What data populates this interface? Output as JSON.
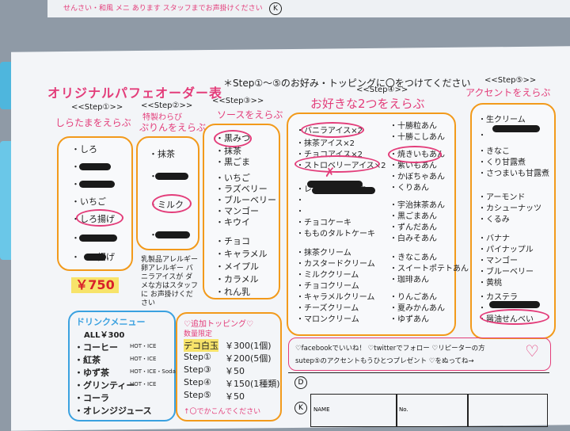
{
  "top": {
    "text": "せんさい・和風 メニ あります スタッフまでお声掛けください",
    "k": "K"
  },
  "title": "オリジナルパフェオーダー表",
  "instruction": "＊Step①〜⑤のお好み・トッピングに〇をつけてください",
  "steps": {
    "s1": "<<Step①>>",
    "s2": "<<Step②>>",
    "s3": "<<Step③>>",
    "s4": "<<Step④>>",
    "s5": "<<Step⑤>>"
  },
  "step1": {
    "sub": "しらたまをえらぶ",
    "items": [
      "・しろ",
      "・",
      "・",
      "・いちご",
      "・しろ揚げ",
      "・",
      "・　　揚げ"
    ]
  },
  "step2": {
    "sub1": "特製わらび",
    "sub2": "ぷりんをえらぶ",
    "items": [
      "・抹茶",
      "・",
      "・ミルク",
      "・"
    ]
  },
  "step3": {
    "sub": "ソースをえらぶ",
    "items": [
      "・黒みつ",
      "・抹茶",
      "・黒ごま",
      "・いちご",
      "・ラズベリー",
      "・ブルーベリー",
      "・マンゴー",
      "・キウイ",
      "・チョコ",
      "・キャラメル",
      "・メイプル",
      "・カラメル",
      "・れん乳"
    ]
  },
  "step4": {
    "sub": "お好きな2つをえらぶ",
    "left": [
      "・バニラアイス×2",
      "・抹茶アイス×2",
      "・チョコアイス×2",
      "・ストロベリーアイス×2",
      "・レアチーズケーキ",
      "・",
      "・",
      "・チョコケーキ",
      "・もものタルトケーキ",
      "・抹茶クリーム",
      "・カスタードクリーム",
      "・ミルククリーム",
      "・チョコクリーム",
      "・キャラメルクリーム",
      "・チーズクリーム",
      "・マロンクリーム"
    ],
    "right": [
      "・十勝粒あん",
      "・十勝こしあん",
      "・焼きいもあん",
      "・紫いもあん",
      "・かぼちゃあん",
      "・くりあん",
      "・宇治抹茶あん",
      "・黒ごまあん",
      "・ずんだあん",
      "・白みそあん",
      "・きなこあん",
      "・スイートポテトあん",
      "・珈琲あん",
      "・りんごあん",
      "・夏みかんあん",
      "・ゆずあん"
    ]
  },
  "step5": {
    "sub": "アクセントをえらぶ",
    "items": [
      "・生クリーム",
      "・",
      "・きなこ",
      "・くり甘露煮",
      "・さつまいも甘露煮",
      "・アーモンド",
      "・カシューナッツ",
      "・くるみ",
      "・バナナ",
      "・パイナップル",
      "・マンゴー",
      "・ブルーベリー",
      "・黄桃",
      "・カステラ",
      "・",
      "・醤油せんべい"
    ]
  },
  "price": "￥750",
  "allergy_note": "乳製品アレルギー 卵アレルギー バニラアイスが ダメな方はスタッフに お声掛けください",
  "drinks": {
    "title": "ドリンクメニュー",
    "all": "ALL￥300",
    "items": [
      {
        "name": "・コーヒー",
        "tag": "HOT・ICE"
      },
      {
        "name": "・紅茶",
        "tag": "HOT・ICE"
      },
      {
        "name": "・ゆず茶",
        "tag": "HOT・ICE・Soda"
      },
      {
        "name": "・グリンティー",
        "tag": "HOT・ICE"
      },
      {
        "name": "・コーラ",
        "tag": ""
      },
      {
        "name": "・オレンジジュース",
        "tag": ""
      }
    ]
  },
  "topping": {
    "title": "♡追加トッピング♡",
    "limited": "数量限定",
    "rows": [
      {
        "label": "デコ白玉",
        "price": "￥300(1個)"
      },
      {
        "label": "Step①",
        "price": "￥200(5個)"
      },
      {
        "label": "Step③",
        "price": "￥50"
      },
      {
        "label": "Step④",
        "price": "￥150(1種類)"
      },
      {
        "label": "Step⑤",
        "price": "￥50"
      }
    ],
    "footer": "↑〇でかこんでください"
  },
  "promo": {
    "line1": "♡facebookでいいね！ ♡twitterでフォロー ♡リピーターの方",
    "line2": "sutep⑤のアクセントもうひとつプレゼント ♡をぬってね→",
    "heart": "♡"
  },
  "form": {
    "d": "D",
    "k": "K",
    "name": "NAME",
    "no": "No."
  },
  "colors": {
    "pink": "#e33d7a",
    "orange": "#f29a1b",
    "blue": "#3aa1e0",
    "paper": "#f3f5f8"
  }
}
